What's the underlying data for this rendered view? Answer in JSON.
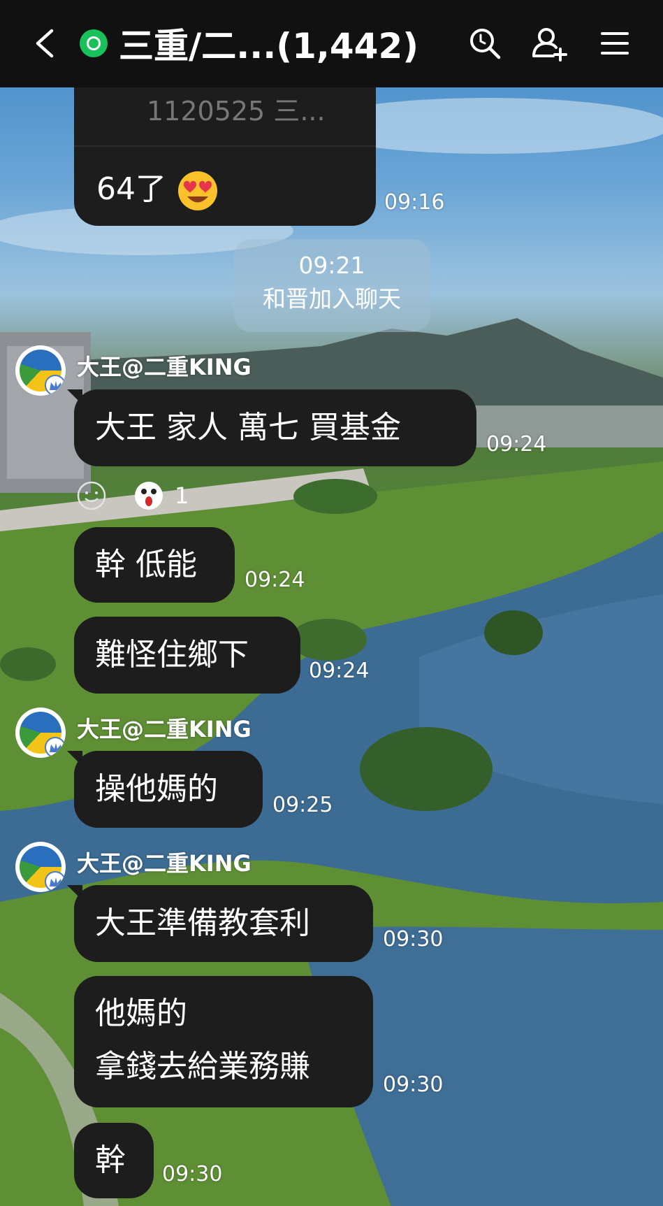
{
  "header": {
    "title": "三重/二...(1,442)"
  },
  "messages": {
    "quote_preview": "1120525 三...",
    "m1_text": "64了",
    "m1_time": "09:16",
    "system_time": "09:21",
    "system_text": "和晋加入聊天",
    "sender_name": "大王@二重KING",
    "m2_text": "大王 家人 萬七 買基金",
    "m2_time": "09:24",
    "reaction_count": "1",
    "m3_text": "幹 低能",
    "m3_time": "09:24",
    "m4_text": "難怪住鄉下",
    "m4_time": "09:24",
    "m5_text": "操他媽的",
    "m5_time": "09:25",
    "m6_text": "大王準備教套利",
    "m6_time": "09:30",
    "m7_line1": "他媽的",
    "m7_line2": "拿錢去給業務賺",
    "m7_time": "09:30",
    "m8_text": "幹",
    "m8_time": "09:30"
  },
  "icons": {
    "back": "chevron-left-icon",
    "status": "open-chat-icon",
    "search": "search-icon",
    "add_friend": "add-friend-icon",
    "menu": "hamburger-menu-icon",
    "emoji_heart": "heart-eyes-emoji-icon",
    "reaction_add": "smiley-outline-icon",
    "reaction_shock": "shocked-face-emoji-icon",
    "admin_badge": "crown-icon"
  },
  "colors": {
    "topbar_bg": "#111111",
    "bubble_bg": "#1d1d1d",
    "status_green": "#19c15a"
  }
}
